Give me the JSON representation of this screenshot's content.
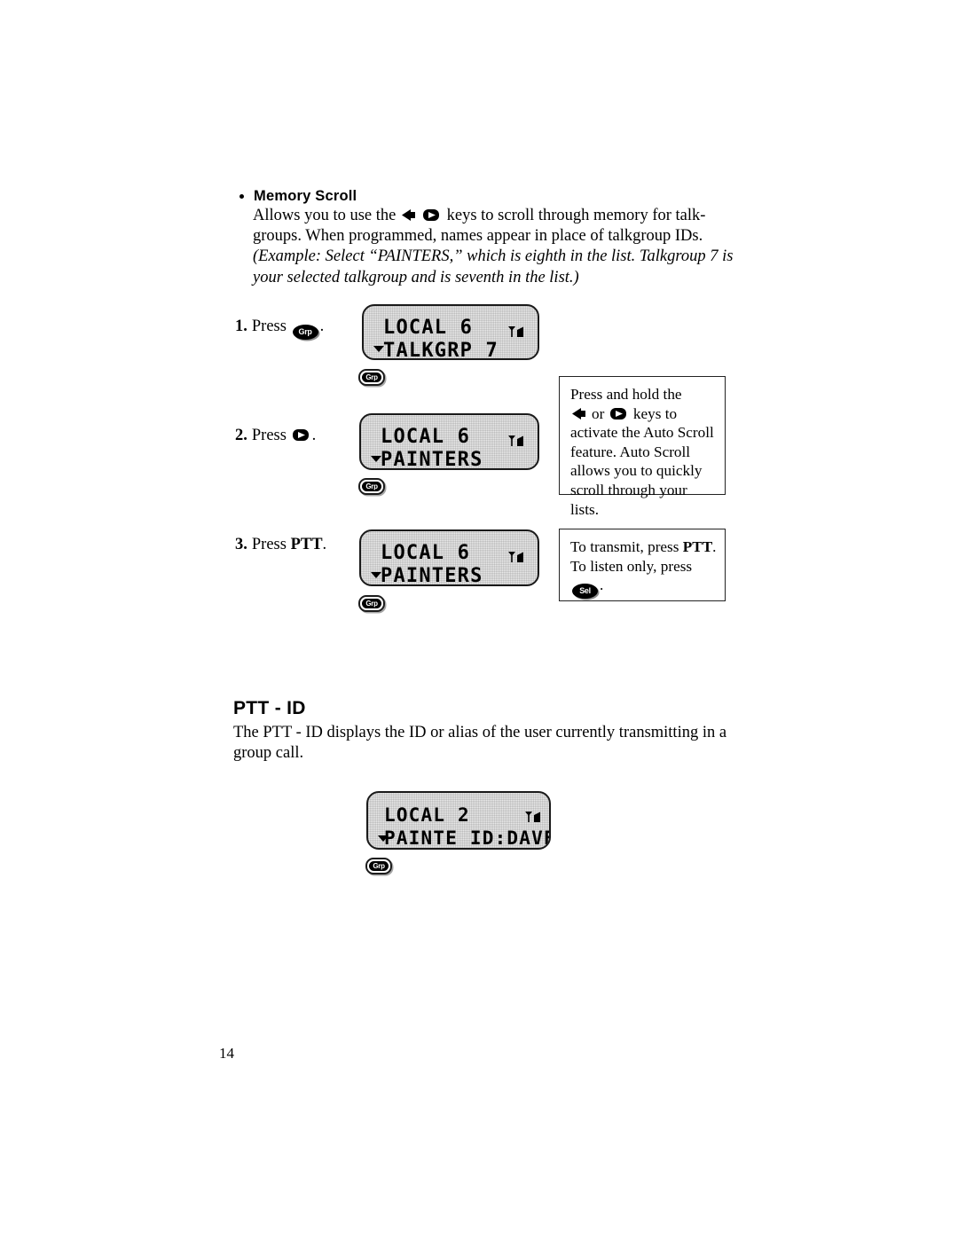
{
  "page": {
    "number": "14"
  },
  "memory_scroll": {
    "heading": "Memory Scroll",
    "para_part1": "Allows you to use the ",
    "para_part2": " keys to scroll through memory for talk-groups. When programmed, names appear in place of talkgroup IDs. ",
    "para_italic": "(Example: Select “PAINTERS,” which is eighth in the list. Talkgroup 7 is your selected talkgroup and is seventh in the list.)"
  },
  "steps": [
    {
      "number": "1.",
      "verb": "Press",
      "button_label": "Grp",
      "trailing": ".",
      "lcd": {
        "line1": "LOCAL 6",
        "line2": "TALKGRP 7",
        "signal_icon": "antenna-signal-icon",
        "caret_icon": "down-caret-icon"
      },
      "hw_key_label": "Grp"
    },
    {
      "number": "2.",
      "verb": "Press",
      "button_label": "right-arrow-key",
      "trailing": ".",
      "lcd": {
        "line1": "LOCAL 6",
        "line2": "PAINTERS",
        "signal_icon": "antenna-signal-icon",
        "caret_icon": "down-caret-icon"
      },
      "hw_key_label": "Grp"
    },
    {
      "number": "3.",
      "verb": "Press",
      "button_label": "PTT",
      "trailing": ".",
      "lcd": {
        "line1": "LOCAL 6",
        "line2": "PAINTERS",
        "signal_icon": "antenna-signal-icon",
        "caret_icon": "down-caret-icon"
      },
      "hw_key_label": "Grp"
    }
  ],
  "callouts": [
    {
      "text_part1": "Press and hold the",
      "mid_word": "or",
      "text_part2": " keys to activate the Auto Scroll feature. Auto Scroll allows you to quickly scroll through your lists.",
      "left_icon": "left-arrow-key-icon",
      "right_icon": "right-arrow-key-icon"
    },
    {
      "line1_pre": "To transmit, press ",
      "line1_bold": "PTT",
      "line1_post": ".",
      "line2_pre": "To listen only, press ",
      "line2_button": "Sel",
      "line2_post": "."
    }
  ],
  "ptt_id": {
    "heading": "PTT - ID",
    "body": "The PTT - ID displays the ID or alias of the user currently transmitting in a group call.",
    "lcd": {
      "line1": "LOCAL 2",
      "line2": "PAINTE ID:DAVE",
      "signal_icon": "antenna-signal-icon",
      "caret_icon": "down-caret-icon"
    },
    "hw_key_label": "Grp"
  }
}
